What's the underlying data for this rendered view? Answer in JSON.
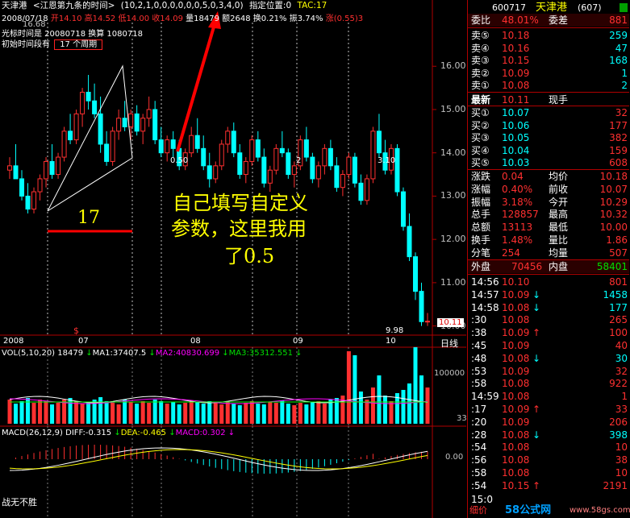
{
  "header": {
    "stock_name": "天津港",
    "indicator": "<江恩第九条的时间>",
    "params": "(10,2,1,0,0,0,0,0,0,5,0,3,4,0)",
    "position_label": "指定位置:0",
    "tac": "TAC:17",
    "date": "2008/07/18",
    "open": "开14.10",
    "high": "高14.52",
    "low": "低14.00",
    "close": "收14.09",
    "volume": "量18479",
    "amount": "额2648",
    "turnover": "换0.21%",
    "amplitude": "振3.74%",
    "change": "涨(0.55)3",
    "price_overlap": "16.68",
    "cursor_time": "光标时间是 20080718 换算 1080718",
    "init_time_prefix": "初始时间段有",
    "init_time_box": "17 个周期"
  },
  "price_axis": [
    "16.00",
    "15.00",
    "14.00",
    "13.00",
    "12.00",
    "11.00",
    "10.00"
  ],
  "price_current": "10.11",
  "price_low_label": "9.98",
  "chart_labels": {
    "marker_050": "0.50",
    "marker_2": "2",
    "marker_310": "3.10",
    "big17": "17",
    "annotation": "自己填写自定义",
    "annotation2": "参数，这里我用",
    "annotation3": "了0.5",
    "dollar": "$"
  },
  "x_axis": [
    "2008",
    "07",
    "08",
    "09",
    "10"
  ],
  "period_label": "日线",
  "vol": {
    "title": "VOL(5,10,20)",
    "value": "18479",
    "ma1": "MA1:37407.5",
    "ma2": "MA2:40830.699",
    "ma3": "MA3:35312.551",
    "axis": [
      "100000",
      "33"
    ]
  },
  "macd": {
    "title": "MACD(26,12,9)",
    "diff": "DIFF:-0.315",
    "dea": "DEA:-0.465",
    "macd": "MACD:0.302",
    "axis": "0.00",
    "footer": "战无不胜"
  },
  "quote": {
    "code": "600717",
    "name": "天津港",
    "count": "(607)",
    "webi_label": "委比",
    "webi": "48.01%",
    "weicha_label": "委差",
    "weicha": "881",
    "sell": [
      {
        "label": "卖⑤",
        "price": "10.18",
        "vol": "259"
      },
      {
        "label": "卖④",
        "price": "10.16",
        "vol": "47"
      },
      {
        "label": "卖③",
        "price": "10.15",
        "vol": "168"
      },
      {
        "label": "卖②",
        "price": "10.09",
        "vol": "1"
      },
      {
        "label": "卖①",
        "price": "10.08",
        "vol": "2"
      }
    ],
    "latest_label": "最新",
    "latest": "10.11",
    "now_hand": "现手",
    "buy": [
      {
        "label": "买①",
        "price": "10.07",
        "vol": "32"
      },
      {
        "label": "买②",
        "price": "10.06",
        "vol": "177"
      },
      {
        "label": "买③",
        "price": "10.05",
        "vol": "382"
      },
      {
        "label": "买④",
        "price": "10.04",
        "vol": "159"
      },
      {
        "label": "买⑤",
        "price": "10.03",
        "vol": "608"
      }
    ],
    "stats": [
      {
        "l1": "涨跌",
        "v1": "0.04",
        "l2": "均价",
        "v2": "10.18"
      },
      {
        "l1": "涨幅",
        "v1": "0.40%",
        "l2": "前收",
        "v2": "10.07"
      },
      {
        "l1": "振幅",
        "v1": "3.18%",
        "l2": "今开",
        "v2": "10.29"
      },
      {
        "l1": "总手",
        "v1": "128857",
        "l2": "最高",
        "v2": "10.32"
      },
      {
        "l1": "总额",
        "v1": "13113",
        "l2": "最低",
        "v2": "10.00"
      },
      {
        "l1": "换手",
        "v1": "1.48%",
        "l2": "量比",
        "v2": "1.86"
      },
      {
        "l1": "分笔",
        "v1": "254",
        "l2": "均量",
        "v2": "507"
      }
    ],
    "outer_label": "外盘",
    "outer": "70456",
    "inner_label": "内盘",
    "inner": "58401",
    "ticks": [
      {
        "t": "14:56",
        "p": "10.10",
        "v": "801",
        "d": ""
      },
      {
        "t": "14:57",
        "p": "10.09",
        "v": "1458",
        "d": "down"
      },
      {
        "t": "14:58",
        "p": "10.08",
        "v": "177",
        "d": "down"
      },
      {
        "t": ":30",
        "p": "10.08",
        "v": "265",
        "d": ""
      },
      {
        "t": ":38",
        "p": "10.09",
        "v": "100",
        "d": "up"
      },
      {
        "t": ":45",
        "p": "10.09",
        "v": "40",
        "d": ""
      },
      {
        "t": ":48",
        "p": "10.08",
        "v": "30",
        "d": "down"
      },
      {
        "t": ":53",
        "p": "10.09",
        "v": "32",
        "d": ""
      },
      {
        "t": ":58",
        "p": "10.08",
        "v": "922",
        "d": ""
      },
      {
        "t": "14:59",
        "p": "10.08",
        "v": "1",
        "d": ""
      },
      {
        "t": ":17",
        "p": "10.09",
        "v": "33",
        "d": "up"
      },
      {
        "t": ":20",
        "p": "10.09",
        "v": "206",
        "d": ""
      },
      {
        "t": ":28",
        "p": "10.08",
        "v": "398",
        "d": "down"
      },
      {
        "t": ":54",
        "p": "10.08",
        "v": "10",
        "d": ""
      },
      {
        "t": ":56",
        "p": "10.08",
        "v": "38",
        "d": ""
      },
      {
        "t": ":58",
        "p": "10.08",
        "v": "10",
        "d": ""
      },
      {
        "t": ":54",
        "p": "10.15",
        "v": "2191",
        "d": "up"
      }
    ],
    "last_time": "15:0",
    "bottom_label": "细价",
    "watermark": "58公式网",
    "watermark_url": "www.58gs.com"
  },
  "chart_data": {
    "type": "candlestick",
    "title": "天津港",
    "ylim": [
      9.9,
      16.6
    ],
    "candles": [
      [
        13.6,
        13.9,
        13.4,
        13.7
      ],
      [
        13.7,
        14.2,
        13.5,
        13.4
      ],
      [
        13.4,
        13.6,
        12.9,
        13.0
      ],
      [
        13.0,
        13.3,
        12.6,
        12.7
      ],
      [
        12.7,
        13.2,
        12.6,
        13.1
      ],
      [
        13.1,
        13.5,
        12.9,
        13.4
      ],
      [
        13.4,
        13.9,
        13.2,
        13.8
      ],
      [
        13.8,
        14.2,
        13.4,
        13.5
      ],
      [
        13.5,
        14.0,
        13.4,
        13.9
      ],
      [
        13.9,
        14.6,
        13.8,
        14.5
      ],
      [
        14.5,
        14.9,
        14.2,
        14.3
      ],
      [
        14.3,
        15.0,
        14.2,
        14.9
      ],
      [
        14.9,
        15.5,
        14.6,
        15.4
      ],
      [
        15.4,
        15.8,
        15.0,
        15.2
      ],
      [
        15.2,
        15.6,
        14.8,
        14.9
      ],
      [
        14.9,
        15.3,
        14.0,
        14.2
      ],
      [
        14.2,
        14.5,
        13.7,
        13.8
      ],
      [
        13.8,
        14.6,
        13.7,
        14.5
      ],
      [
        14.5,
        15.0,
        14.3,
        14.8
      ],
      [
        14.8,
        15.2,
        14.5,
        14.6
      ],
      [
        14.6,
        15.0,
        14.3,
        14.9
      ],
      [
        14.9,
        15.1,
        14.4,
        14.5
      ],
      [
        14.5,
        14.9,
        14.2,
        14.8
      ],
      [
        14.8,
        15.3,
        14.6,
        15.0
      ],
      [
        15.0,
        15.2,
        14.2,
        14.3
      ],
      [
        14.3,
        14.6,
        13.9,
        14.0
      ],
      [
        14.0,
        14.4,
        13.8,
        14.3
      ],
      [
        14.3,
        14.5,
        13.9,
        14.1
      ],
      [
        14.1,
        14.3,
        13.6,
        13.7
      ],
      [
        13.7,
        14.1,
        13.6,
        14.0
      ],
      [
        14.0,
        14.6,
        13.9,
        14.4
      ],
      [
        14.4,
        14.8,
        14.0,
        14.1
      ],
      [
        14.1,
        14.4,
        13.6,
        13.7
      ],
      [
        13.7,
        14.0,
        13.2,
        13.4
      ],
      [
        13.4,
        13.8,
        13.3,
        13.7
      ],
      [
        13.7,
        14.3,
        13.6,
        14.2
      ],
      [
        14.2,
        14.6,
        14.0,
        14.5
      ],
      [
        14.5,
        14.7,
        13.9,
        14.0
      ],
      [
        14.0,
        14.2,
        13.4,
        13.5
      ],
      [
        13.5,
        13.9,
        13.3,
        13.8
      ],
      [
        13.8,
        14.4,
        13.7,
        14.3
      ],
      [
        14.3,
        14.5,
        13.8,
        13.9
      ],
      [
        13.9,
        14.1,
        13.2,
        13.3
      ],
      [
        13.3,
        13.7,
        13.1,
        13.6
      ],
      [
        13.6,
        14.2,
        13.5,
        14.1
      ],
      [
        14.1,
        14.5,
        13.9,
        14.0
      ],
      [
        14.0,
        14.1,
        13.4,
        13.5
      ],
      [
        13.5,
        13.8,
        13.2,
        13.7
      ],
      [
        13.7,
        14.4,
        13.6,
        14.3
      ],
      [
        14.3,
        14.6,
        13.8,
        13.9
      ],
      [
        13.9,
        14.0,
        13.3,
        13.4
      ],
      [
        13.4,
        13.8,
        13.2,
        13.7
      ],
      [
        13.7,
        14.2,
        13.5,
        14.1
      ],
      [
        14.1,
        14.3,
        13.6,
        13.7
      ],
      [
        13.7,
        13.9,
        13.1,
        13.2
      ],
      [
        13.2,
        13.6,
        13.0,
        13.5
      ],
      [
        13.5,
        14.0,
        13.4,
        13.9
      ],
      [
        13.9,
        14.0,
        13.2,
        13.3
      ],
      [
        13.3,
        13.5,
        12.8,
        12.9
      ],
      [
        12.9,
        13.5,
        12.8,
        13.4
      ],
      [
        13.4,
        14.6,
        13.3,
        14.5
      ],
      [
        14.5,
        14.9,
        13.9,
        14.0
      ],
      [
        14.0,
        14.3,
        13.5,
        13.6
      ],
      [
        13.6,
        14.2,
        13.5,
        14.1
      ],
      [
        14.1,
        14.2,
        13.0,
        13.1
      ],
      [
        13.1,
        13.2,
        12.2,
        12.3
      ],
      [
        12.3,
        12.6,
        11.5,
        11.6
      ],
      [
        11.6,
        11.7,
        10.6,
        10.8
      ],
      [
        10.8,
        11.0,
        10.0,
        10.1
      ],
      [
        10.1,
        10.3,
        10.0,
        10.11
      ]
    ]
  }
}
